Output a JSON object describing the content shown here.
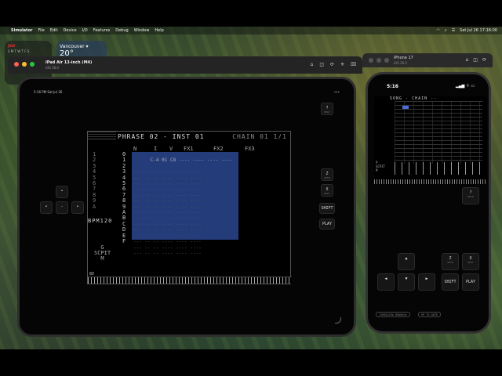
{
  "menubar": {
    "app": "Simulator",
    "menus": [
      "File",
      "Edit",
      "Device",
      "I/O",
      "Features",
      "Debug",
      "Window",
      "Help"
    ],
    "clock": "Sat Jul 26 17:16:00"
  },
  "widgets": {
    "calendar_month": "JULY",
    "calendar_days": "S M T W T F S",
    "weather_city": "Vancouver ▾",
    "weather_temp": "20°"
  },
  "ipad_window": {
    "title": "iPad Air 13-inch (M4)",
    "subtitle": "iOS 26.0"
  },
  "iphone_window": {
    "title": "iPhone 17",
    "subtitle": "iOS 26.0"
  },
  "ipad": {
    "status_time": "5:16 PM  Sat Jul 26",
    "status_right": "•••",
    "buttons": {
      "help": "?",
      "help_sub": "HELP",
      "z": "Z",
      "z_sub": "OPTN",
      "x": "X",
      "x_sub": "EDIT",
      "shift": "SHIFT",
      "play": "PLAY"
    },
    "tracker": {
      "header": "PHRASE 02 - INST 01",
      "header_right": "CHAIN 01 1/1",
      "col_n": "N",
      "col_i": "I",
      "col_v": "V",
      "col_fx1": "FX1",
      "col_fx2": "FX2",
      "col_fx3": "FX3",
      "left_rows": "1\n2\n3\n4\n5\n6\n7\n8\n9\nA",
      "step_rows": "0\n1\n2\n3\n4\n5\n6\n7\n8\n9\nA\nB\nC\nD\nE\nF",
      "first_row": "C-4 01 C8 ---- ---- ---- ----",
      "bpm": "BPM120",
      "scpit": "G\nSCPIT\nM",
      "keys_label": "8V"
    }
  },
  "iphone": {
    "time": "5:16",
    "status_icons": "▂▄▆  ⌔  ▭",
    "screen_header": "SONG - CHAIN --",
    "scpit": "P\nSCPIT\nM",
    "buttons": {
      "help": "?",
      "help_sub": "HELP",
      "z": "Z",
      "z_sub": "OPTN",
      "x": "X",
      "x_sub": "EDIT",
      "shift": "SHIFT",
      "play": "PLAY"
    },
    "chip_left": "17682425A 89b8e4c",
    "chip_right": "UP TO DATE"
  }
}
